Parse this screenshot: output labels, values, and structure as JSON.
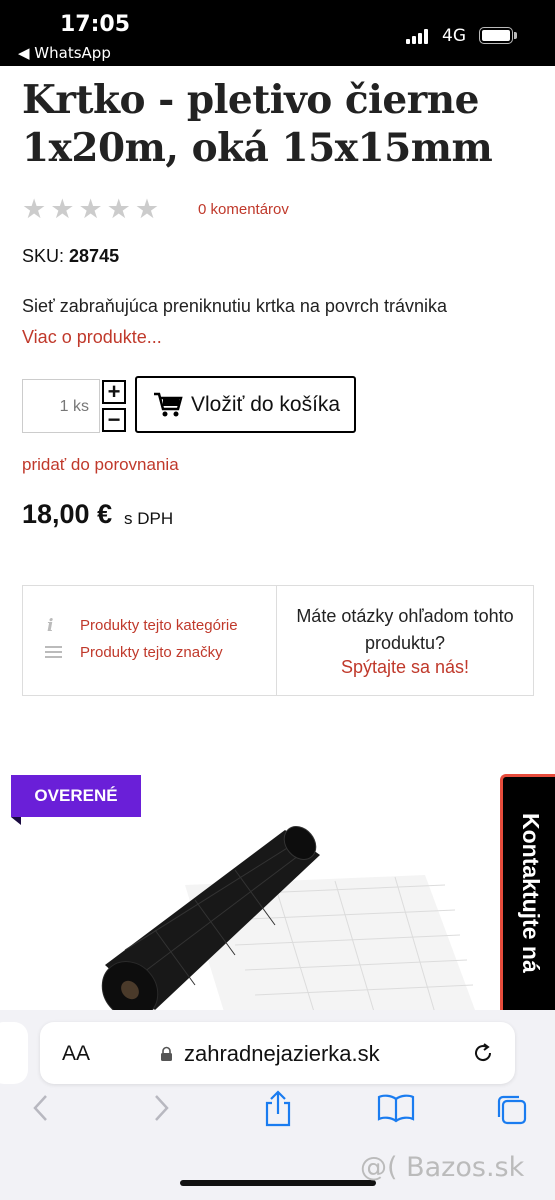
{
  "status_bar": {
    "time": "17:05",
    "back_app": "◀ WhatsApp",
    "network": "4G"
  },
  "product": {
    "title": "Krtko - pletivo čierne 1x20m, oká 15x15mm",
    "comments": "0 komentárov",
    "sku_label": "SKU:",
    "sku_value": "28745",
    "description": "Sieť zabraňujúca preniknutiu krtka na povrch trávnika",
    "more_link": "Viac o produkte...",
    "quantity": "1 ks",
    "add_to_cart": "Vložiť do košíka",
    "compare": "pridať do porovnania",
    "price": "18,00 €",
    "price_suffix": "s DPH",
    "rating": 0,
    "rating_max": 5
  },
  "info_box": {
    "category_link": "Produkty tejto kategórie",
    "brand_link": "Produkty tejto značky",
    "question": "Máte otázky ohľadom tohto produktu?",
    "ask_link": "Spýtajte sa nás!"
  },
  "badge": {
    "label": "OVERENÉ",
    "color": "#6a1fd8"
  },
  "contact_tab": {
    "label": "Kontaktujte ná"
  },
  "browser": {
    "aa_label": "AA",
    "url": "zahradnejazierka.sk"
  },
  "watermark": "@( Bazos.sk",
  "colors": {
    "link": "#c0392b",
    "badge": "#6a1fd8",
    "contact_border": "#e74c3c",
    "ios_blue": "#1a7cf0"
  }
}
